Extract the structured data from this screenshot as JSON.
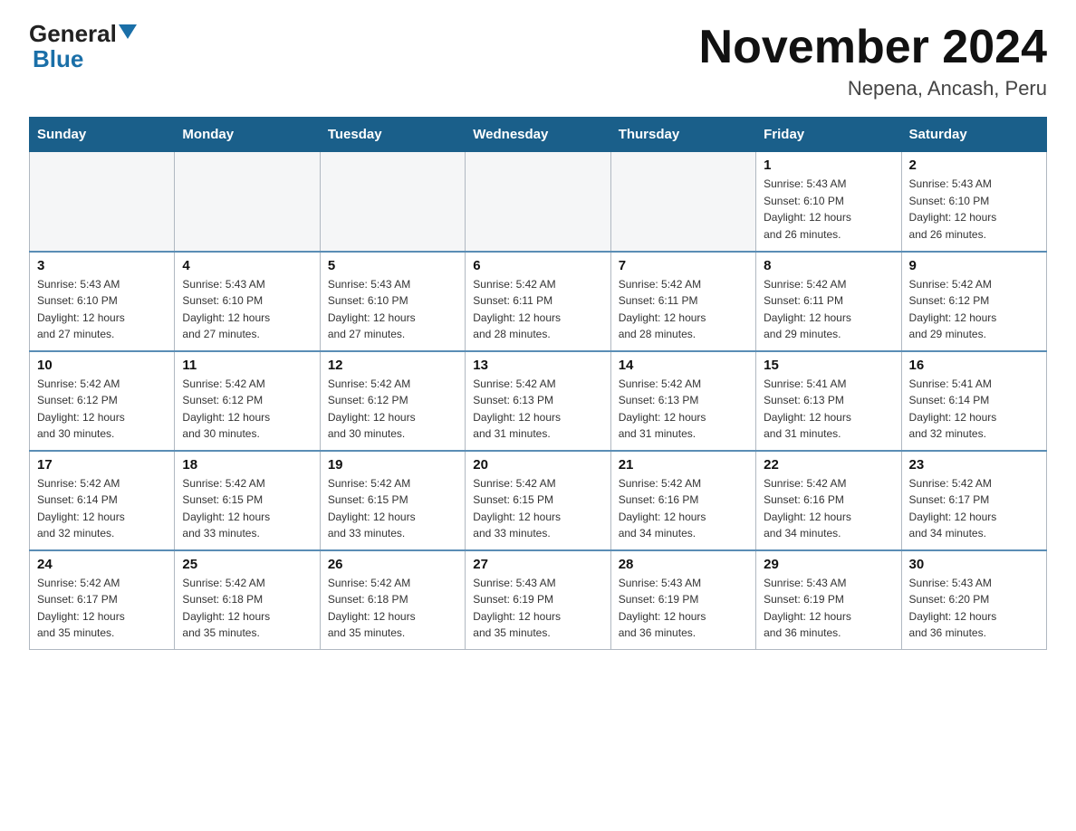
{
  "header": {
    "logo_general": "General",
    "logo_blue": "Blue",
    "month_title": "November 2024",
    "location": "Nepena, Ancash, Peru"
  },
  "weekdays": [
    "Sunday",
    "Monday",
    "Tuesday",
    "Wednesday",
    "Thursday",
    "Friday",
    "Saturday"
  ],
  "weeks": [
    [
      {
        "day": "",
        "info": ""
      },
      {
        "day": "",
        "info": ""
      },
      {
        "day": "",
        "info": ""
      },
      {
        "day": "",
        "info": ""
      },
      {
        "day": "",
        "info": ""
      },
      {
        "day": "1",
        "info": "Sunrise: 5:43 AM\nSunset: 6:10 PM\nDaylight: 12 hours\nand 26 minutes."
      },
      {
        "day": "2",
        "info": "Sunrise: 5:43 AM\nSunset: 6:10 PM\nDaylight: 12 hours\nand 26 minutes."
      }
    ],
    [
      {
        "day": "3",
        "info": "Sunrise: 5:43 AM\nSunset: 6:10 PM\nDaylight: 12 hours\nand 27 minutes."
      },
      {
        "day": "4",
        "info": "Sunrise: 5:43 AM\nSunset: 6:10 PM\nDaylight: 12 hours\nand 27 minutes."
      },
      {
        "day": "5",
        "info": "Sunrise: 5:43 AM\nSunset: 6:10 PM\nDaylight: 12 hours\nand 27 minutes."
      },
      {
        "day": "6",
        "info": "Sunrise: 5:42 AM\nSunset: 6:11 PM\nDaylight: 12 hours\nand 28 minutes."
      },
      {
        "day": "7",
        "info": "Sunrise: 5:42 AM\nSunset: 6:11 PM\nDaylight: 12 hours\nand 28 minutes."
      },
      {
        "day": "8",
        "info": "Sunrise: 5:42 AM\nSunset: 6:11 PM\nDaylight: 12 hours\nand 29 minutes."
      },
      {
        "day": "9",
        "info": "Sunrise: 5:42 AM\nSunset: 6:12 PM\nDaylight: 12 hours\nand 29 minutes."
      }
    ],
    [
      {
        "day": "10",
        "info": "Sunrise: 5:42 AM\nSunset: 6:12 PM\nDaylight: 12 hours\nand 30 minutes."
      },
      {
        "day": "11",
        "info": "Sunrise: 5:42 AM\nSunset: 6:12 PM\nDaylight: 12 hours\nand 30 minutes."
      },
      {
        "day": "12",
        "info": "Sunrise: 5:42 AM\nSunset: 6:12 PM\nDaylight: 12 hours\nand 30 minutes."
      },
      {
        "day": "13",
        "info": "Sunrise: 5:42 AM\nSunset: 6:13 PM\nDaylight: 12 hours\nand 31 minutes."
      },
      {
        "day": "14",
        "info": "Sunrise: 5:42 AM\nSunset: 6:13 PM\nDaylight: 12 hours\nand 31 minutes."
      },
      {
        "day": "15",
        "info": "Sunrise: 5:41 AM\nSunset: 6:13 PM\nDaylight: 12 hours\nand 31 minutes."
      },
      {
        "day": "16",
        "info": "Sunrise: 5:41 AM\nSunset: 6:14 PM\nDaylight: 12 hours\nand 32 minutes."
      }
    ],
    [
      {
        "day": "17",
        "info": "Sunrise: 5:42 AM\nSunset: 6:14 PM\nDaylight: 12 hours\nand 32 minutes."
      },
      {
        "day": "18",
        "info": "Sunrise: 5:42 AM\nSunset: 6:15 PM\nDaylight: 12 hours\nand 33 minutes."
      },
      {
        "day": "19",
        "info": "Sunrise: 5:42 AM\nSunset: 6:15 PM\nDaylight: 12 hours\nand 33 minutes."
      },
      {
        "day": "20",
        "info": "Sunrise: 5:42 AM\nSunset: 6:15 PM\nDaylight: 12 hours\nand 33 minutes."
      },
      {
        "day": "21",
        "info": "Sunrise: 5:42 AM\nSunset: 6:16 PM\nDaylight: 12 hours\nand 34 minutes."
      },
      {
        "day": "22",
        "info": "Sunrise: 5:42 AM\nSunset: 6:16 PM\nDaylight: 12 hours\nand 34 minutes."
      },
      {
        "day": "23",
        "info": "Sunrise: 5:42 AM\nSunset: 6:17 PM\nDaylight: 12 hours\nand 34 minutes."
      }
    ],
    [
      {
        "day": "24",
        "info": "Sunrise: 5:42 AM\nSunset: 6:17 PM\nDaylight: 12 hours\nand 35 minutes."
      },
      {
        "day": "25",
        "info": "Sunrise: 5:42 AM\nSunset: 6:18 PM\nDaylight: 12 hours\nand 35 minutes."
      },
      {
        "day": "26",
        "info": "Sunrise: 5:42 AM\nSunset: 6:18 PM\nDaylight: 12 hours\nand 35 minutes."
      },
      {
        "day": "27",
        "info": "Sunrise: 5:43 AM\nSunset: 6:19 PM\nDaylight: 12 hours\nand 35 minutes."
      },
      {
        "day": "28",
        "info": "Sunrise: 5:43 AM\nSunset: 6:19 PM\nDaylight: 12 hours\nand 36 minutes."
      },
      {
        "day": "29",
        "info": "Sunrise: 5:43 AM\nSunset: 6:19 PM\nDaylight: 12 hours\nand 36 minutes."
      },
      {
        "day": "30",
        "info": "Sunrise: 5:43 AM\nSunset: 6:20 PM\nDaylight: 12 hours\nand 36 minutes."
      }
    ]
  ]
}
